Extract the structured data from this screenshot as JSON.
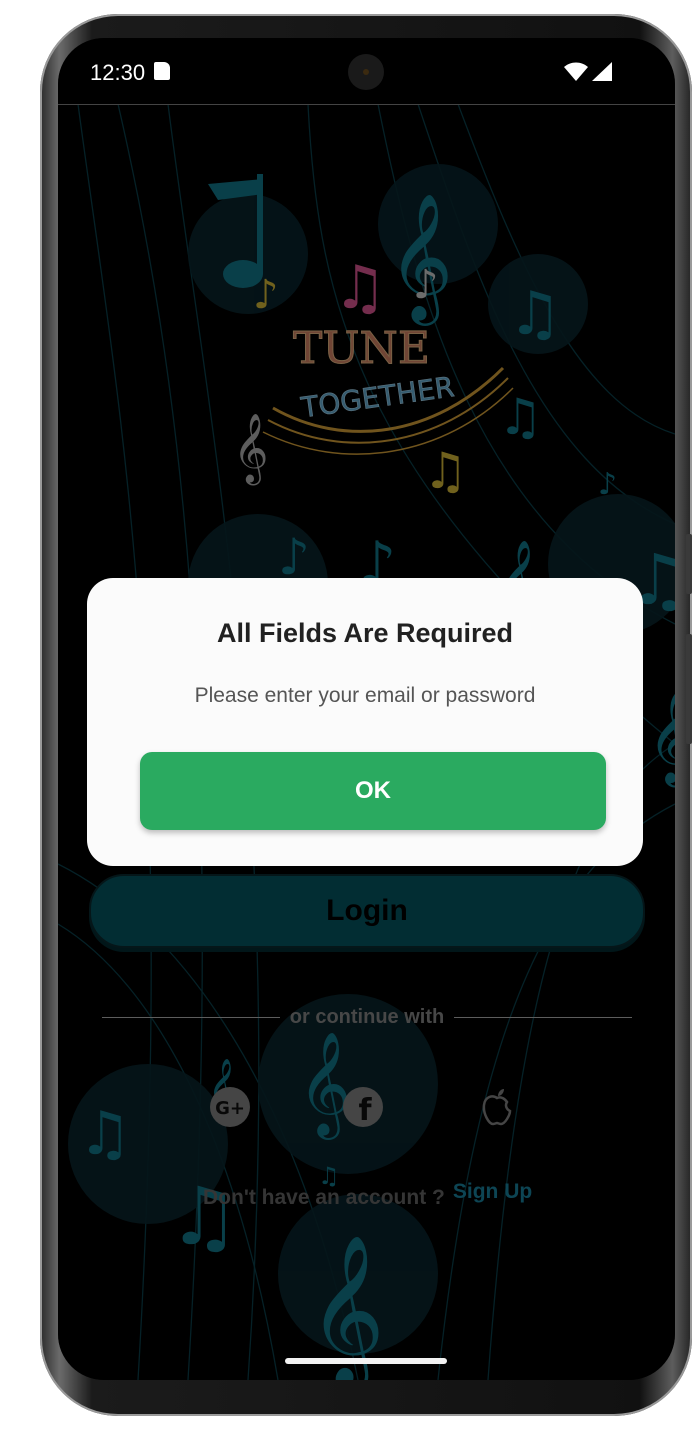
{
  "status_bar": {
    "time": "12:30"
  },
  "logo": {
    "line1": "TUNE",
    "line2": "TOGETHER"
  },
  "login_button": "Login",
  "divider": "or continue with",
  "social": [
    {
      "name": "google-plus",
      "label": "G+"
    },
    {
      "name": "facebook",
      "label": "f"
    },
    {
      "name": "apple",
      "label": ""
    }
  ],
  "signup": {
    "question": "Don't have an account ?",
    "link": "Sign Up"
  },
  "dialog": {
    "title": "All Fields Are Required",
    "message": "Please enter your email or password",
    "ok": "OK"
  },
  "colors": {
    "accent_green": "#2aaa60",
    "login_teal": "#045a66",
    "link_blue": "#1a8aa8",
    "note_teal": "#137f93"
  }
}
